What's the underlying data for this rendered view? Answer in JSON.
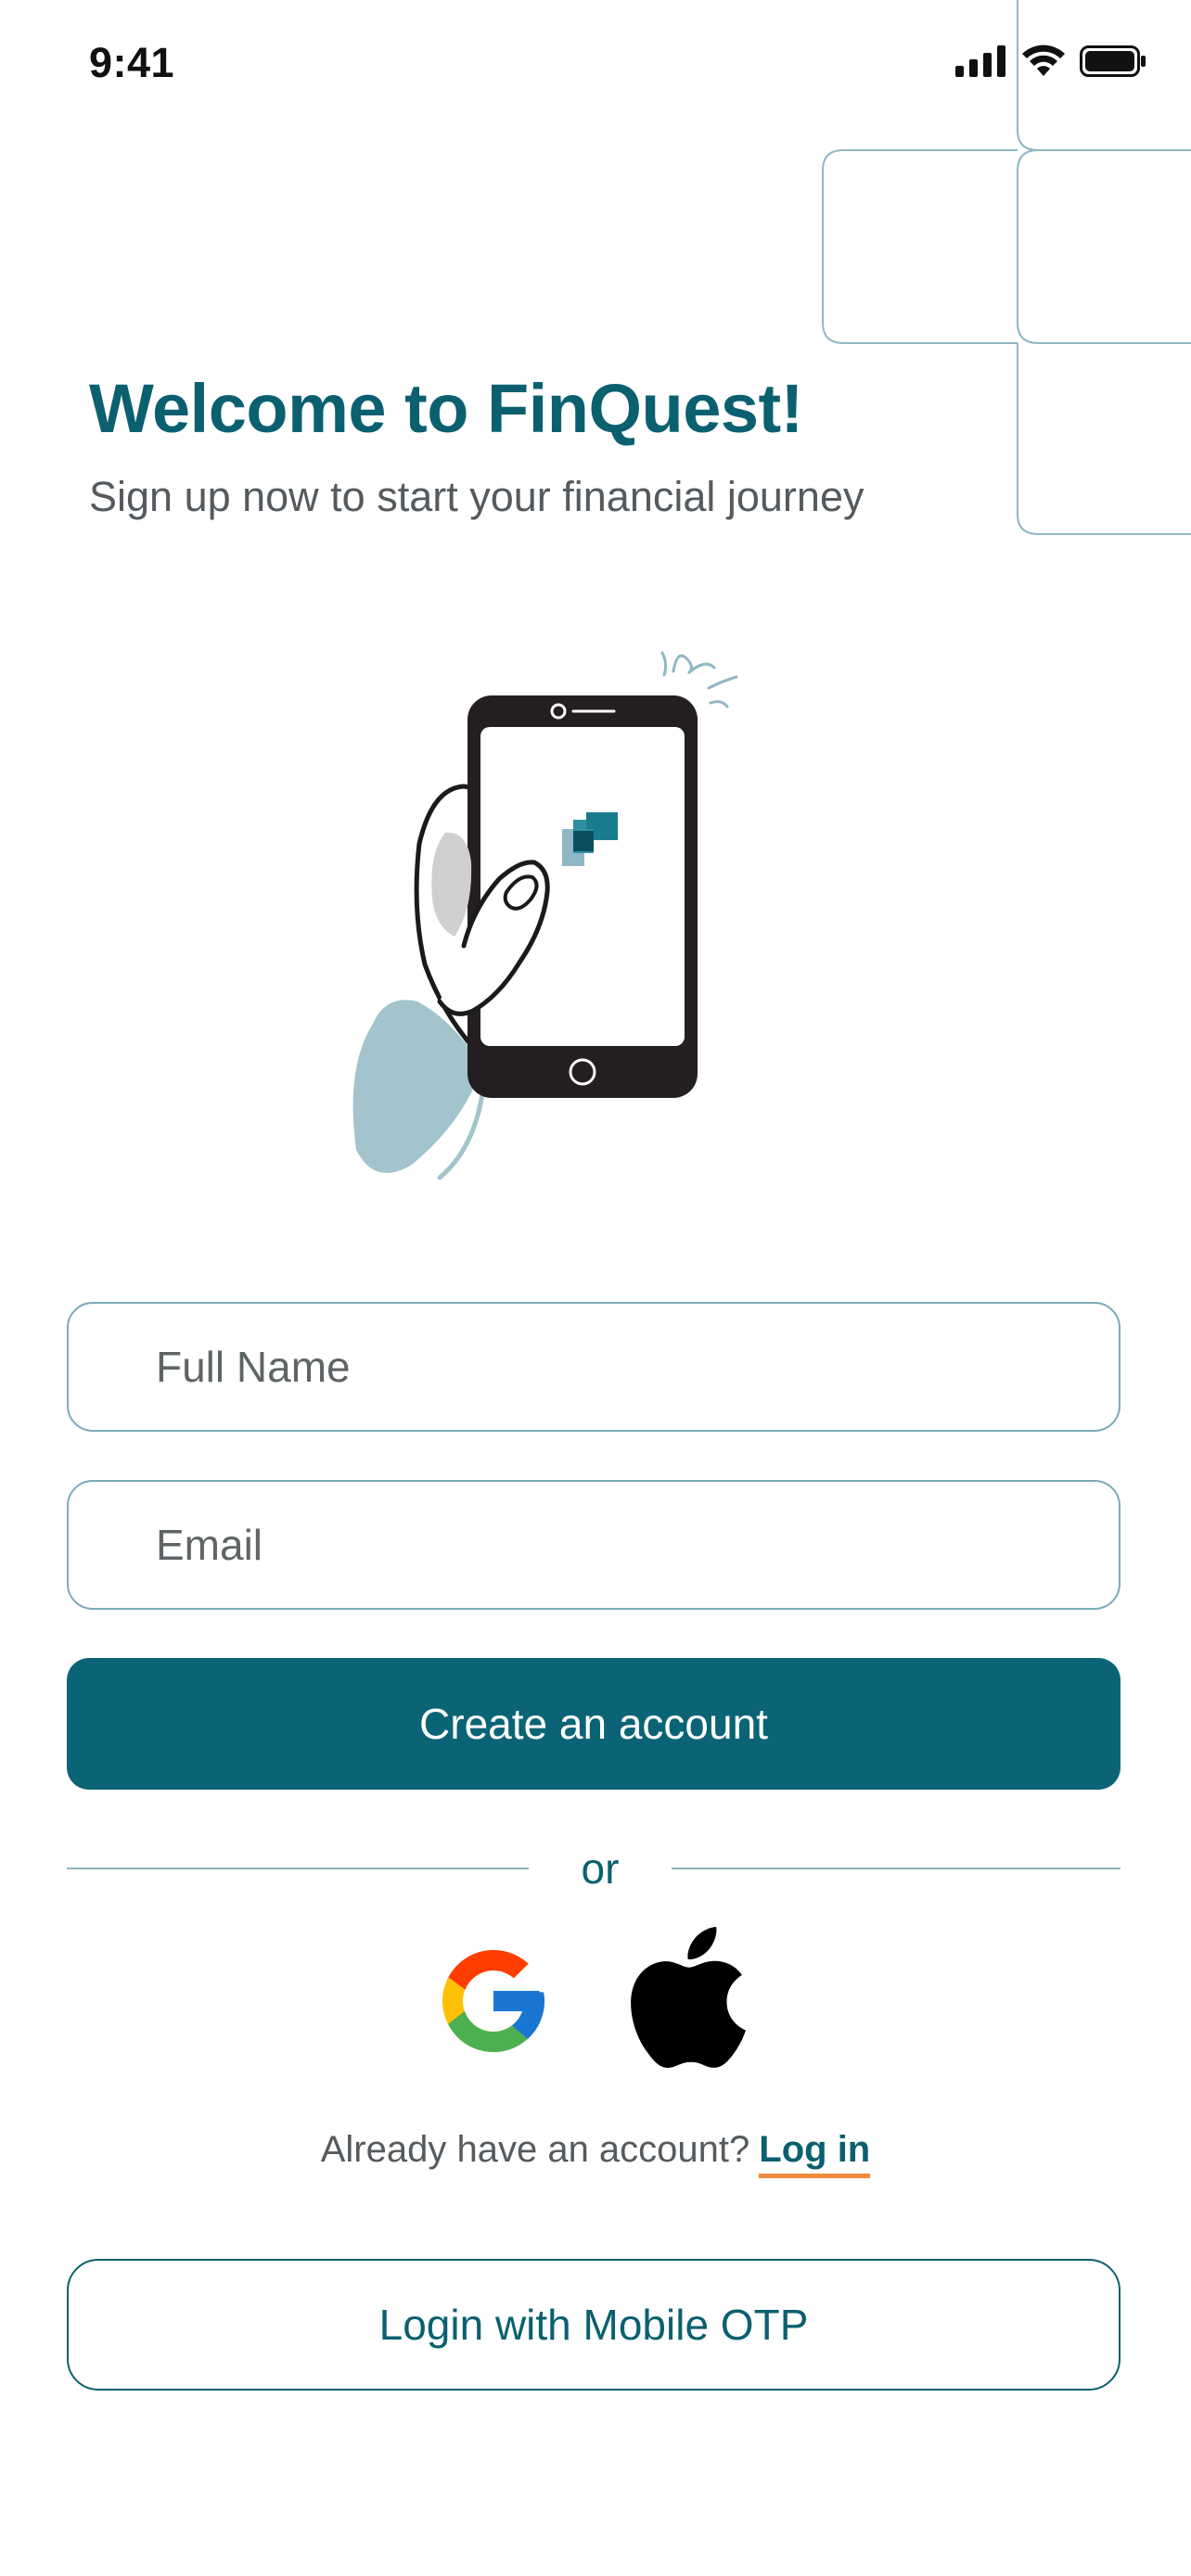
{
  "status_bar": {
    "time": "9:41",
    "icons": [
      "cellular-signal-icon",
      "wifi-icon",
      "battery-icon"
    ]
  },
  "welcome": {
    "title": "Welcome to FinQuest!",
    "subtitle": "Sign up now to start your financial journey"
  },
  "form": {
    "full_name": {
      "value": "",
      "placeholder": "Full Name"
    },
    "email": {
      "value": "",
      "placeholder": "Email"
    },
    "create_label": "Create an account"
  },
  "divider_text": "or",
  "social": [
    {
      "icon": "google-icon"
    },
    {
      "icon": "apple-icon"
    }
  ],
  "login_prompt": {
    "text": "Already have an account?",
    "link": "Log in"
  },
  "otp_label": "Login with Mobile OTP",
  "colors": {
    "primary": "#0b6475",
    "title": "#0b6070",
    "border": "#7aaab8",
    "link_underline": "#f08a3c",
    "illustration_accent": "#a3c4cc"
  }
}
